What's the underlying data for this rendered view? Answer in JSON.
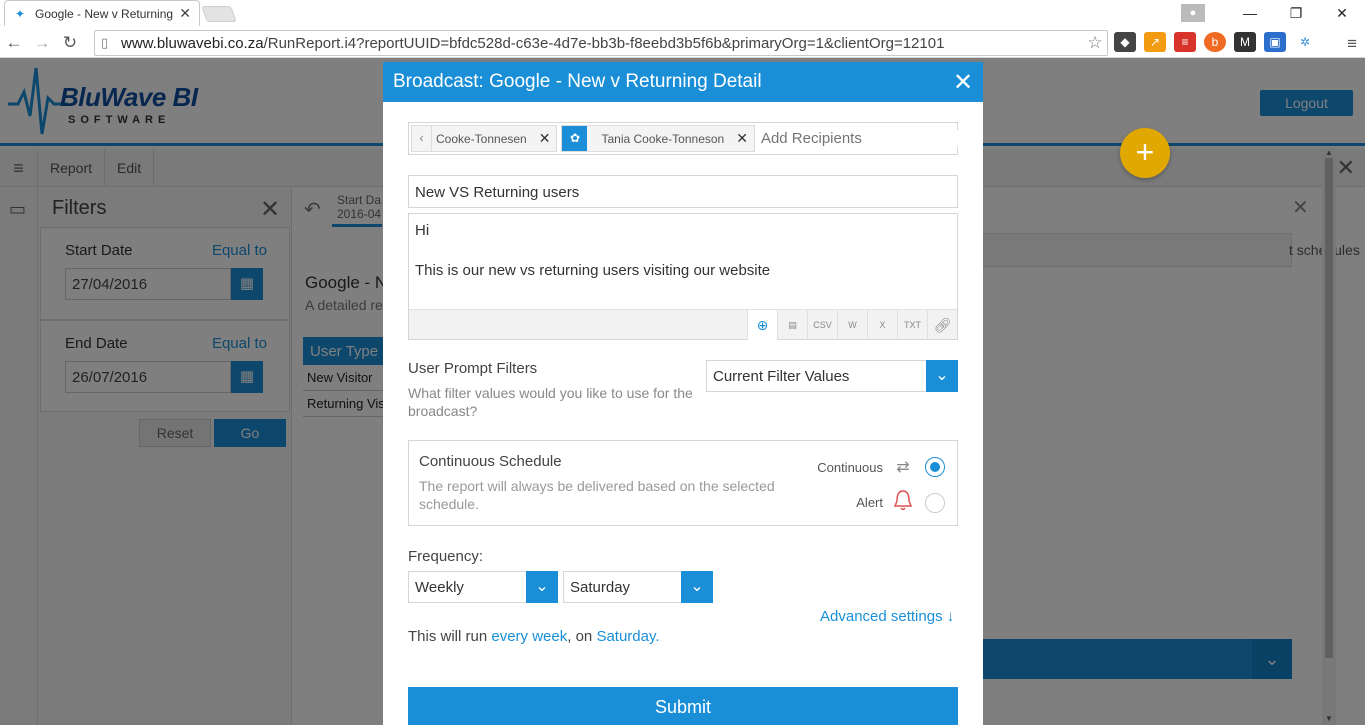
{
  "browser": {
    "tab_title": "Google - New v Returning",
    "url_host": "www.bluwavebi.co.za",
    "url_path": "/RunReport.i4?reportUUID=bfdc528d-c63e-4d7e-bb3b-f8eebd3b5f6b&primaryOrg=1&clientOrg=12101"
  },
  "app": {
    "logo_text": "BluWave BI",
    "logo_sub": "SOFTWARE",
    "logout_label": "Logout",
    "toolbar": {
      "report_label": "Report",
      "edit_label": "Edit"
    },
    "filters": {
      "title": "Filters",
      "start_label": "Start Date",
      "start_op": "Equal to",
      "start_value": "27/04/2016",
      "end_label": "End Date",
      "end_op": "Equal to",
      "end_value": "26/07/2016",
      "reset_label": "Reset",
      "go_label": "Go"
    },
    "report": {
      "date_tab_line1": "Start Da",
      "date_tab_line2": "2016-04",
      "title": "Google - N",
      "subtitle": "A detailed re",
      "table_header": "User Type",
      "rows": [
        "New Visitor",
        "Returning Visi"
      ],
      "schedules_text": "t schedules"
    }
  },
  "modal": {
    "title": "Broadcast: Google - New v Returning Detail",
    "recipients": [
      {
        "name": "Cooke-Tonnesen"
      },
      {
        "name": "Tania Cooke-Tonneson"
      }
    ],
    "recipients_placeholder": "Add Recipients",
    "subject": "New VS Returning users",
    "message_line1": "Hi",
    "message_line2": "This is our new vs returning users visiting our website",
    "formats": [
      "CSV",
      "W",
      "X",
      "TXT"
    ],
    "user_prompt": {
      "label": "User Prompt Filters",
      "help": "What filter values would you like to use for the broadcast?",
      "selected": "Current Filter Values"
    },
    "schedule": {
      "title": "Continuous Schedule",
      "help": "The report will always be delivered based on the selected schedule.",
      "continuous_label": "Continuous",
      "alert_label": "Alert"
    },
    "frequency": {
      "label": "Frequency:",
      "period": "Weekly",
      "day": "Saturday"
    },
    "advanced_label": "Advanced settings",
    "run_prefix": "This will run",
    "run_period": "every week",
    "run_mid": ", on",
    "run_day": "Saturday",
    "run_suffix": ".",
    "submit_label": "Submit"
  },
  "colors": {
    "accent": "#1a8fd8",
    "fab": "#e0a800",
    "alert_icon": "#e05050"
  }
}
